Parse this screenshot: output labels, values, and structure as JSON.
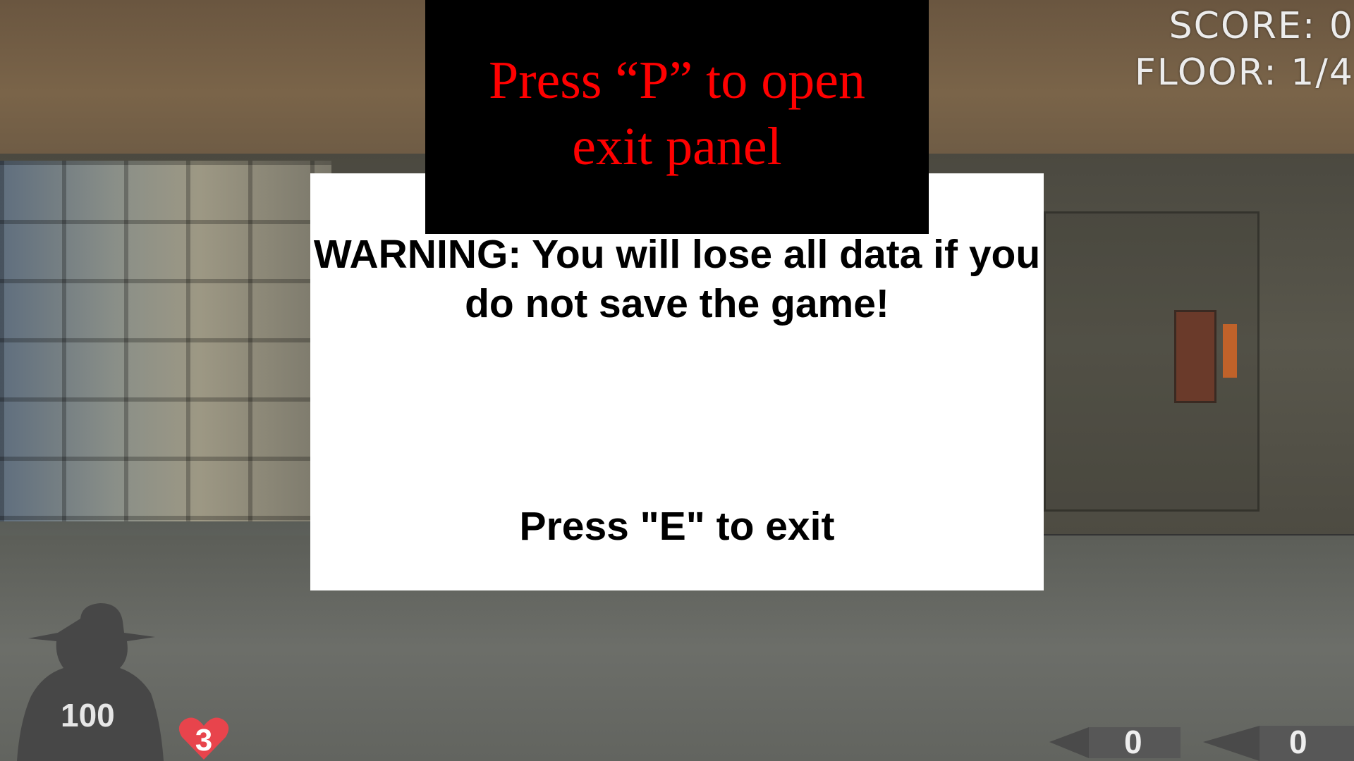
{
  "hint": {
    "text": "Press “P” to open exit panel"
  },
  "exit_panel": {
    "warning": "WARNING: You will lose all data if you do not save the game!",
    "exit_prompt": "Press \"E\" to exit"
  },
  "hud": {
    "score_text": "SCORE: 0",
    "floor_text": "FLOOR: 1/4",
    "health": "100",
    "lives": "3",
    "ammo_primary": "0",
    "ammo_secondary": "0"
  },
  "colors": {
    "hint_text": "#ff0000",
    "hint_background": "#000000",
    "panel_background": "#ffffff",
    "heart": "#e8444c"
  },
  "icons": [
    "player-silhouette-icon",
    "heart-icon",
    "bullet-icon"
  ]
}
